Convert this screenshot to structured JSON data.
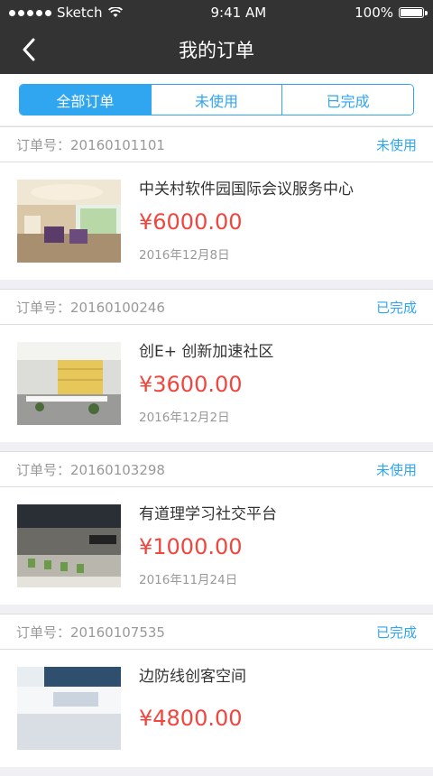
{
  "status": {
    "carrier": "Sketch",
    "time": "9:41 AM",
    "battery": "100%"
  },
  "nav": {
    "title": "我的订单"
  },
  "tabs": [
    {
      "label": "全部订单",
      "active": true
    },
    {
      "label": "未使用",
      "active": false
    },
    {
      "label": "已完成",
      "active": false
    }
  ],
  "orders": [
    {
      "no_label": "订单号：20160101101",
      "status": "未使用",
      "title": "中关村软件园国际会议服务中心",
      "price": "¥6000.00",
      "date": "2016年12月8日"
    },
    {
      "no_label": "订单号：20160100246",
      "status": "已完成",
      "title": "创E+ 创新加速社区",
      "price": "¥3600.00",
      "date": "2016年12月2日"
    },
    {
      "no_label": "订单号：20160103298",
      "status": "未使用",
      "title": "有道理学习社交平台",
      "price": "¥1000.00",
      "date": "2016年11月24日"
    },
    {
      "no_label": "订单号：20160107535",
      "status": "已完成",
      "title": "边防线创客空间",
      "price": "¥4800.00",
      "date": ""
    }
  ],
  "colors": {
    "accent": "#2fa6ef",
    "price": "#f0463f",
    "bar": "#333333"
  }
}
